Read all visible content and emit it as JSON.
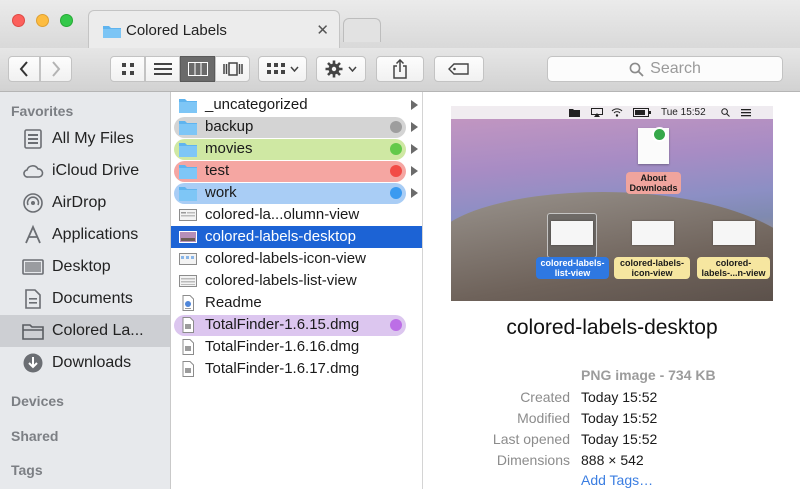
{
  "window": {
    "tab_title": "Colored Labels",
    "tab_close": "✕"
  },
  "toolbar": {
    "search_placeholder": "Search"
  },
  "sidebar": {
    "sections": [
      "Favorites",
      "Devices",
      "Shared",
      "Tags"
    ],
    "items": [
      {
        "label": "All My Files",
        "icon": "all-files-icon"
      },
      {
        "label": "iCloud Drive",
        "icon": "cloud-icon"
      },
      {
        "label": "AirDrop",
        "icon": "airdrop-icon"
      },
      {
        "label": "Applications",
        "icon": "applications-icon"
      },
      {
        "label": "Desktop",
        "icon": "desktop-icon"
      },
      {
        "label": "Documents",
        "icon": "documents-icon"
      },
      {
        "label": "Colored La...",
        "icon": "folder-icon",
        "selected": true
      },
      {
        "label": "Downloads",
        "icon": "downloads-icon"
      }
    ]
  },
  "files": [
    {
      "name": "_uncategorized",
      "kind": "folder",
      "tag": null
    },
    {
      "name": "backup",
      "kind": "folder",
      "tag": "gray"
    },
    {
      "name": "movies",
      "kind": "folder",
      "tag": "green"
    },
    {
      "name": "test",
      "kind": "folder",
      "tag": "red"
    },
    {
      "name": "work",
      "kind": "folder",
      "tag": "blue"
    },
    {
      "name": "colored-la...olumn-view",
      "kind": "image",
      "tag": null
    },
    {
      "name": "colored-labels-desktop",
      "kind": "image",
      "tag": null,
      "selected": true
    },
    {
      "name": "colored-labels-icon-view",
      "kind": "image",
      "tag": null
    },
    {
      "name": "colored-labels-list-view",
      "kind": "image",
      "tag": null
    },
    {
      "name": "Readme",
      "kind": "doc",
      "tag": null
    },
    {
      "name": "TotalFinder-1.6.15.dmg",
      "kind": "dmg",
      "tag": "purple"
    },
    {
      "name": "TotalFinder-1.6.16.dmg",
      "kind": "dmg",
      "tag": null
    },
    {
      "name": "TotalFinder-1.6.17.dmg",
      "kind": "dmg",
      "tag": null
    }
  ],
  "tag_colors": {
    "gray": {
      "pill": "#d4d4d4",
      "dot": "#9e9e9e"
    },
    "green": {
      "pill": "#cfe8a3",
      "dot": "#62c94a"
    },
    "red": {
      "pill": "#f5a6a2",
      "dot": "#f24b46"
    },
    "blue": {
      "pill": "#a9cdf5",
      "dot": "#3a9af0"
    },
    "purple": {
      "pill": "#dcc6ef",
      "dot": "#bc6ee6"
    }
  },
  "accent": "#1c63d5",
  "preview": {
    "title": "colored-labels-desktop",
    "kind": "PNG image - 734 KB",
    "menubar_time": "Tue 15:52",
    "desktop_labels": {
      "about": "About Downloads",
      "list": "colored-labels-list-view",
      "icon": "colored-labels-icon-view",
      "column": "colored-labels-...n-view"
    },
    "meta": [
      {
        "key": "Created",
        "value": "Today 15:52"
      },
      {
        "key": "Modified",
        "value": "Today 15:52"
      },
      {
        "key": "Last opened",
        "value": "Today 15:52"
      },
      {
        "key": "Dimensions",
        "value": "888 × 542"
      }
    ],
    "add_tags": "Add Tags…"
  }
}
